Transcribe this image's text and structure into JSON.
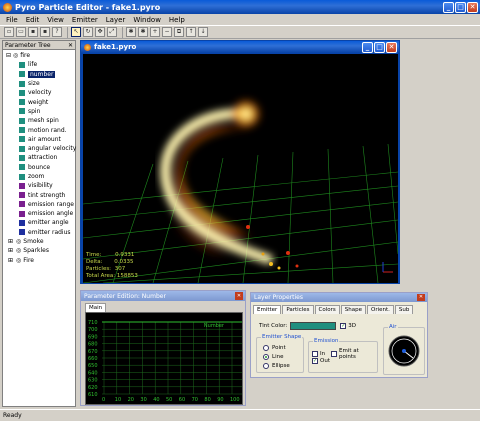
{
  "app": {
    "title": "Pyro Particle Editor - fake1.pyro"
  },
  "menu": [
    "File",
    "Edit",
    "View",
    "Emitter",
    "Layer",
    "Window",
    "Help"
  ],
  "tree": {
    "header": "Parameter Tree",
    "root": "fire",
    "items": [
      {
        "label": "life",
        "color": "#1f8f7f"
      },
      {
        "label": "number",
        "color": "#1f8f7f",
        "selected": true
      },
      {
        "label": "size",
        "color": "#1f8f7f"
      },
      {
        "label": "velocity",
        "color": "#1f8f7f"
      },
      {
        "label": "weight",
        "color": "#1f8f7f"
      },
      {
        "label": "spin",
        "color": "#1f8f7f"
      },
      {
        "label": "mesh spin",
        "color": "#1f8f7f"
      },
      {
        "label": "motion rand.",
        "color": "#1f8f7f"
      },
      {
        "label": "air amount",
        "color": "#1f8f7f"
      },
      {
        "label": "angular velocity",
        "color": "#1f8f7f"
      },
      {
        "label": "attraction",
        "color": "#1f8f7f"
      },
      {
        "label": "bounce",
        "color": "#1f8f7f"
      },
      {
        "label": "zoom",
        "color": "#1f8f7f"
      },
      {
        "label": "visibility",
        "color": "#7a1f8f"
      },
      {
        "label": "tint strength",
        "color": "#7a1f8f"
      },
      {
        "label": "emission range",
        "color": "#7a1f8f"
      },
      {
        "label": "emission angle",
        "color": "#7a1f8f"
      },
      {
        "label": "emitter angle",
        "color": "#1f2f9f"
      },
      {
        "label": "emitter radius",
        "color": "#1f2f9f"
      }
    ],
    "groups": [
      "Smoke",
      "Sparkles",
      "Fire"
    ]
  },
  "viewport": {
    "title": "fake1.pyro",
    "stats": {
      "time": "Time:",
      "time_val": "0.9331",
      "delta": "Delta:",
      "delta_val": "0.0335",
      "particles": "Particles:",
      "particles_val": "307",
      "area": "Total Area:",
      "area_val": "158853"
    }
  },
  "param_editor": {
    "title": "Parameter Edition: Number",
    "tab": "Main",
    "curve_label": "Number",
    "y_ticks": [
      "710",
      "700",
      "690",
      "680",
      "670",
      "660",
      "650",
      "640",
      "630",
      "620",
      "610"
    ],
    "x_ticks": [
      "0",
      "10",
      "20",
      "30",
      "40",
      "50",
      "60",
      "70",
      "80",
      "90",
      "100"
    ]
  },
  "layer_props": {
    "title": "Layer Properties",
    "tabs": [
      "Emitter",
      "Particles",
      "Colors",
      "Shape",
      "Orient.",
      "Sub"
    ],
    "tint_label": "Tint Color:",
    "tint_color": "#1f8f7f",
    "check_3d": "3D",
    "emitter_shape": {
      "label": "Emitter Shape",
      "options": [
        "Point",
        "Line",
        "Ellipse"
      ],
      "selected": "Line"
    },
    "emission": {
      "label": "Emission",
      "in": "In",
      "out": "Out",
      "emit_at_points": "Emit at points"
    },
    "air_label": "Air"
  },
  "status": {
    "text": "Ready"
  }
}
